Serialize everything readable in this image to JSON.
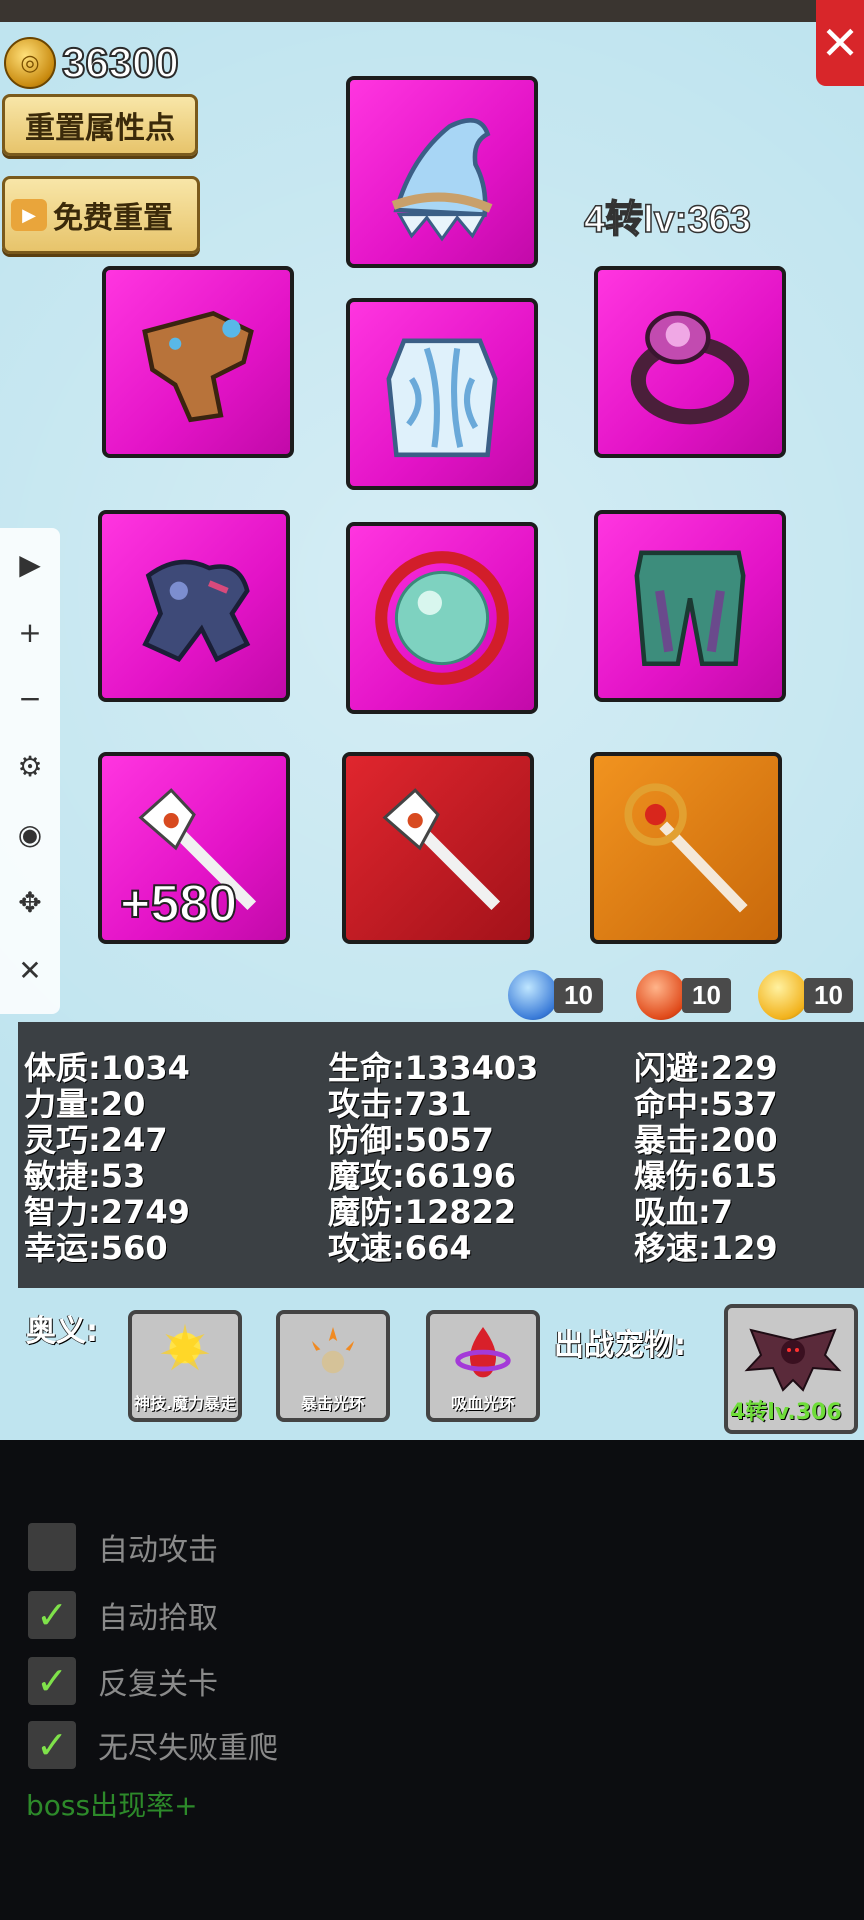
{
  "header": {
    "close_icon": "✕",
    "gold": "36300",
    "coin_icon": "coin-icon",
    "reset_points_label": "重置属性点",
    "free_reset_label": "免费重置",
    "rank_level": "4转lv:363"
  },
  "equipment": {
    "slots": [
      {
        "name": "hat",
        "icon": "wizard-hat-icon",
        "rarity": "pink"
      },
      {
        "name": "gloves",
        "icon": "gloves-icon",
        "rarity": "pink"
      },
      {
        "name": "armor",
        "icon": "robe-icon",
        "rarity": "pink"
      },
      {
        "name": "ring",
        "icon": "ring-icon",
        "rarity": "pink"
      },
      {
        "name": "shoulder",
        "icon": "pauldron-icon",
        "rarity": "pink"
      },
      {
        "name": "orb",
        "icon": "orb-icon",
        "rarity": "pink"
      },
      {
        "name": "pants",
        "icon": "pants-icon",
        "rarity": "pink"
      },
      {
        "name": "weapon",
        "icon": "axe-icon",
        "rarity": "pink",
        "enhance": "+580"
      },
      {
        "name": "weapon2",
        "icon": "axe-icon",
        "rarity": "red"
      },
      {
        "name": "staff",
        "icon": "staff-icon",
        "rarity": "orange"
      }
    ]
  },
  "sidebar": {
    "play": "▶",
    "zoom_in": "+",
    "zoom_out": "−",
    "settings": "⚙",
    "view": "◉",
    "move": "✥",
    "close": "✕"
  },
  "gems": {
    "blue": "10",
    "red": "10",
    "yellow": "10"
  },
  "stats": {
    "col1": [
      "体质:1034",
      "力量:20",
      "灵巧:247",
      "敏捷:53",
      "智力:2749",
      "幸运:560"
    ],
    "col2": [
      "生命:133403",
      "攻击:731",
      "防御:5057",
      "魔攻:66196",
      "魔防:12822",
      "攻速:664"
    ],
    "col3": [
      "闪避:229",
      "命中:537",
      "暴击:200",
      "爆伤:615",
      "吸血:7",
      "移速:129"
    ]
  },
  "secrets": {
    "label": "奥义:",
    "skills": [
      "神技.魔力暴走",
      "暴击光环",
      "吸血光环"
    ]
  },
  "pet": {
    "label": "出战宠物:",
    "level": "4转lv.306"
  },
  "options": [
    {
      "label": "自动攻击",
      "checked": false
    },
    {
      "label": "自动拾取",
      "checked": true
    },
    {
      "label": "反复关卡",
      "checked": true
    },
    {
      "label": "无尽失败重爬",
      "checked": true
    }
  ],
  "boss_rate": "boss出现率+",
  "colors": {
    "panel": "#bfe4ef",
    "pink": "#e313c7",
    "red": "#a3121a",
    "orange": "#f1931f",
    "stats_bg": "#3b4044"
  }
}
